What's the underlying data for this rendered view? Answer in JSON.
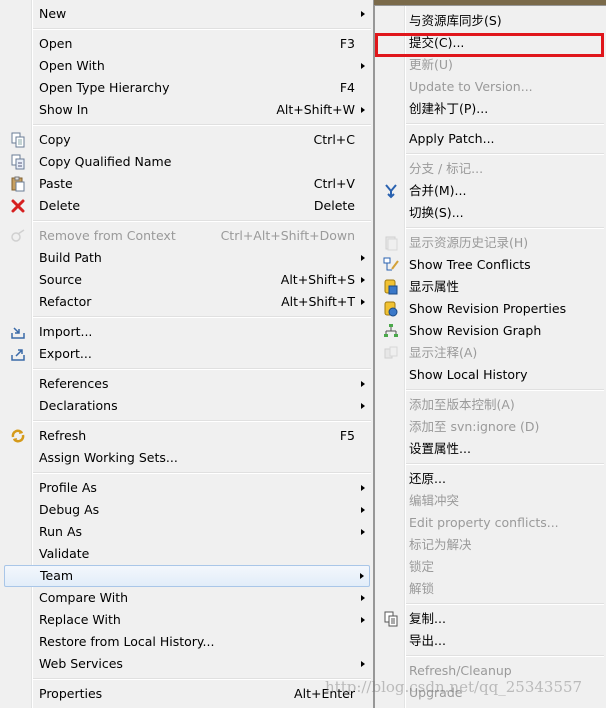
{
  "main_menu": [
    {
      "label": "New",
      "submenu": true
    },
    {
      "sep": true
    },
    {
      "label": "Open",
      "accel": "F3"
    },
    {
      "label": "Open With",
      "submenu": true
    },
    {
      "label": "Open Type Hierarchy",
      "accel": "F4"
    },
    {
      "label": "Show In",
      "accel": "Alt+Shift+W",
      "submenu": true
    },
    {
      "sep": true
    },
    {
      "label": "Copy",
      "accel": "Ctrl+C",
      "icon": "copy-icon"
    },
    {
      "label": "Copy Qualified Name",
      "icon": "copy-qualified-icon"
    },
    {
      "label": "Paste",
      "accel": "Ctrl+V",
      "icon": "paste-icon"
    },
    {
      "label": "Delete",
      "accel": "Delete",
      "icon": "delete-icon"
    },
    {
      "sep": true
    },
    {
      "label": "Remove from Context",
      "accel": "Ctrl+Alt+Shift+Down",
      "disabled": true,
      "icon": "remove-context-icon"
    },
    {
      "label": "Build Path",
      "submenu": true
    },
    {
      "label": "Source",
      "accel": "Alt+Shift+S",
      "submenu": true
    },
    {
      "label": "Refactor",
      "accel": "Alt+Shift+T",
      "submenu": true
    },
    {
      "sep": true
    },
    {
      "label": "Import...",
      "icon": "import-icon"
    },
    {
      "label": "Export...",
      "icon": "export-icon"
    },
    {
      "sep": true
    },
    {
      "label": "References",
      "submenu": true
    },
    {
      "label": "Declarations",
      "submenu": true
    },
    {
      "sep": true
    },
    {
      "label": "Refresh",
      "accel": "F5",
      "icon": "refresh-icon"
    },
    {
      "label": "Assign Working Sets..."
    },
    {
      "sep": true
    },
    {
      "label": "Profile As",
      "submenu": true
    },
    {
      "label": "Debug As",
      "submenu": true
    },
    {
      "label": "Run As",
      "submenu": true
    },
    {
      "label": "Validate"
    },
    {
      "label": "Team",
      "submenu": true,
      "highlighted": true
    },
    {
      "label": "Compare With",
      "submenu": true
    },
    {
      "label": "Replace With",
      "submenu": true
    },
    {
      "label": "Restore from Local History..."
    },
    {
      "label": "Web Services",
      "submenu": true
    },
    {
      "sep": true
    },
    {
      "label": "Properties",
      "accel": "Alt+Enter"
    }
  ],
  "team_menu": [
    {
      "label": "与资源库同步(S)"
    },
    {
      "label": "提交(C)...",
      "boxed": true
    },
    {
      "label": "更新(U)",
      "disabled": true
    },
    {
      "label": "Update to Version...",
      "disabled": true
    },
    {
      "label": "创建补丁(P)..."
    },
    {
      "sep": true
    },
    {
      "label": "Apply Patch..."
    },
    {
      "sep": true
    },
    {
      "label": "分支 / 标记...",
      "disabled": true
    },
    {
      "label": "合并(M)...",
      "icon": "merge-icon"
    },
    {
      "label": "切换(S)..."
    },
    {
      "sep": true
    },
    {
      "label": "显示资源历史记录(H)",
      "disabled": true,
      "icon": "history-icon"
    },
    {
      "label": "Show Tree Conflicts",
      "icon": "tree-conflicts-icon"
    },
    {
      "label": "显示属性",
      "icon": "properties-icon"
    },
    {
      "label": "Show Revision Properties",
      "icon": "revision-properties-icon"
    },
    {
      "label": "Show Revision Graph",
      "icon": "revision-graph-icon"
    },
    {
      "label": "显示注释(A)",
      "disabled": true,
      "icon": "annotate-icon"
    },
    {
      "label": "Show Local History"
    },
    {
      "sep": true
    },
    {
      "label": "添加至版本控制(A)",
      "disabled": true
    },
    {
      "label": "添加至 svn:ignore (D)",
      "disabled": true
    },
    {
      "label": "设置属性..."
    },
    {
      "sep": true
    },
    {
      "label": "还原..."
    },
    {
      "label": "编辑冲突",
      "disabled": true
    },
    {
      "label": "Edit property conflicts...",
      "disabled": true
    },
    {
      "label": "标记为解决",
      "disabled": true
    },
    {
      "label": "锁定",
      "disabled": true
    },
    {
      "label": "解锁",
      "disabled": true
    },
    {
      "sep": true
    },
    {
      "label": "复制...",
      "icon": "copy-svn-icon"
    },
    {
      "label": "导出..."
    },
    {
      "sep": true
    },
    {
      "label": "Refresh/Cleanup",
      "disabled": true
    },
    {
      "label": "Upgrade",
      "disabled": true
    }
  ],
  "watermark": "http://blog.csdn.net/qq_25343557",
  "colors": {
    "highlight_border": "#a9c6e8",
    "red_box": "#e0161b",
    "disabled_text": "#9a9a9a"
  }
}
